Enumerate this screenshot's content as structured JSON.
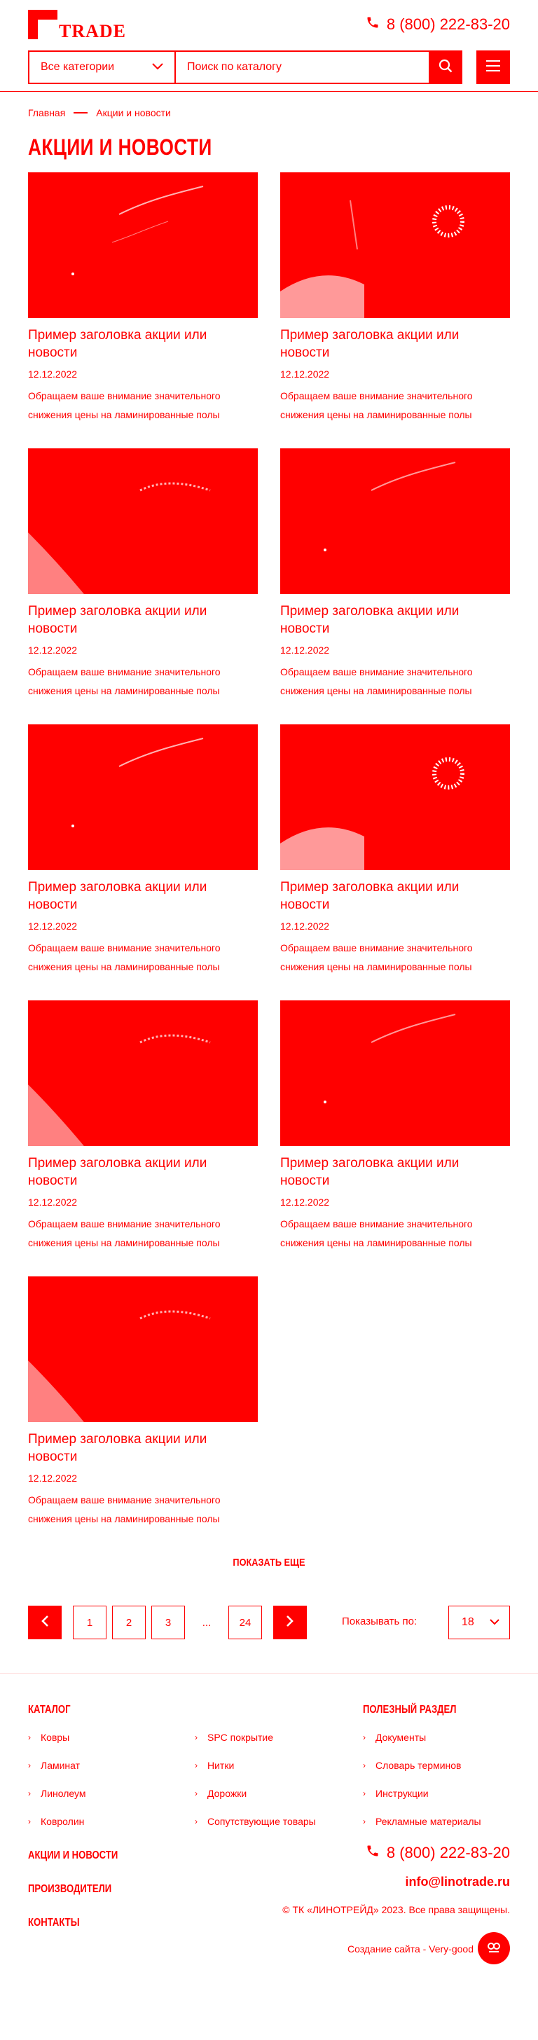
{
  "header": {
    "logo_text": "TRADE",
    "phone": "8 (800) 222-83-20",
    "category_select": "Все категории",
    "search_placeholder": "Поиск по каталогу"
  },
  "breadcrumb": {
    "home": "Главная",
    "current": "Акции и новости"
  },
  "page_title": "АКЦИИ И НОВОСТИ",
  "cards": [
    {
      "title": "Пример заголовка акции или новости",
      "date": "12.12.2022",
      "text": "Обращаем ваше внимание значительного снижения цены на ламинированные полы"
    },
    {
      "title": "Пример заголовка акции или новости",
      "date": "12.12.2022",
      "text": "Обращаем ваше внимание значительного снижения цены на ламинированные полы"
    },
    {
      "title": "Пример заголовка акции или новости",
      "date": "12.12.2022",
      "text": "Обращаем ваше внимание значительного снижения цены на ламинированные полы"
    },
    {
      "title": "Пример заголовка акции или новости",
      "date": "12.12.2022",
      "text": "Обращаем ваше внимание значительного снижения цены на ламинированные полы"
    },
    {
      "title": "Пример заголовка акции или новости",
      "date": "12.12.2022",
      "text": "Обращаем ваше внимание значительного снижения цены на ламинированные полы"
    },
    {
      "title": "Пример заголовка акции или новости",
      "date": "12.12.2022",
      "text": "Обращаем ваше внимание значительного снижения цены на ламинированные полы"
    },
    {
      "title": "Пример заголовка акции или новости",
      "date": "12.12.2022",
      "text": "Обращаем ваше внимание значительного снижения цены на ламинированные полы"
    },
    {
      "title": "Пример заголовка акции или новости",
      "date": "12.12.2022",
      "text": "Обращаем ваше внимание значительного снижения цены на ламинированные полы"
    },
    {
      "title": "Пример заголовка акции или новости",
      "date": "12.12.2022",
      "text": "Обращаем ваше внимание значительного снижения цены на ламинированные полы"
    }
  ],
  "show_more": "ПОКАЗАТЬ ЕЩЕ",
  "pagination": {
    "pages": [
      "1",
      "2",
      "3"
    ],
    "ellipsis": "...",
    "last": "24",
    "show_label": "Показывать по:",
    "per_page": "18"
  },
  "footer": {
    "catalog_title": "КАТАЛОГ",
    "catalog_col1": [
      "Ковры",
      "Ламинат",
      "Линолеум",
      "Ковролин"
    ],
    "catalog_col2": [
      "SPC покрытие",
      "Нитки",
      "Дорожки",
      "Сопутствующие товары"
    ],
    "useful_title": "ПОЛЕЗНЫЙ РАЗДЕЛ",
    "useful_links": [
      "Документы",
      "Словарь терминов",
      "Инструкции",
      "Рекламные материалы"
    ],
    "news_link": "АКЦИИ И НОВОСТИ",
    "producers_link": "ПРОИЗВОДИТЕЛИ",
    "contacts_link": "КОНТАКТЫ",
    "phone": "8 (800) 222-83-20",
    "email": "info@linotrade.ru",
    "copyright": "© ТК «ЛИНОТРЕЙД» 2023. Все права защищены.",
    "developer": "Создание сайта - Very-good"
  },
  "colors": {
    "accent": "#ff0000",
    "background": "#ffffff"
  }
}
